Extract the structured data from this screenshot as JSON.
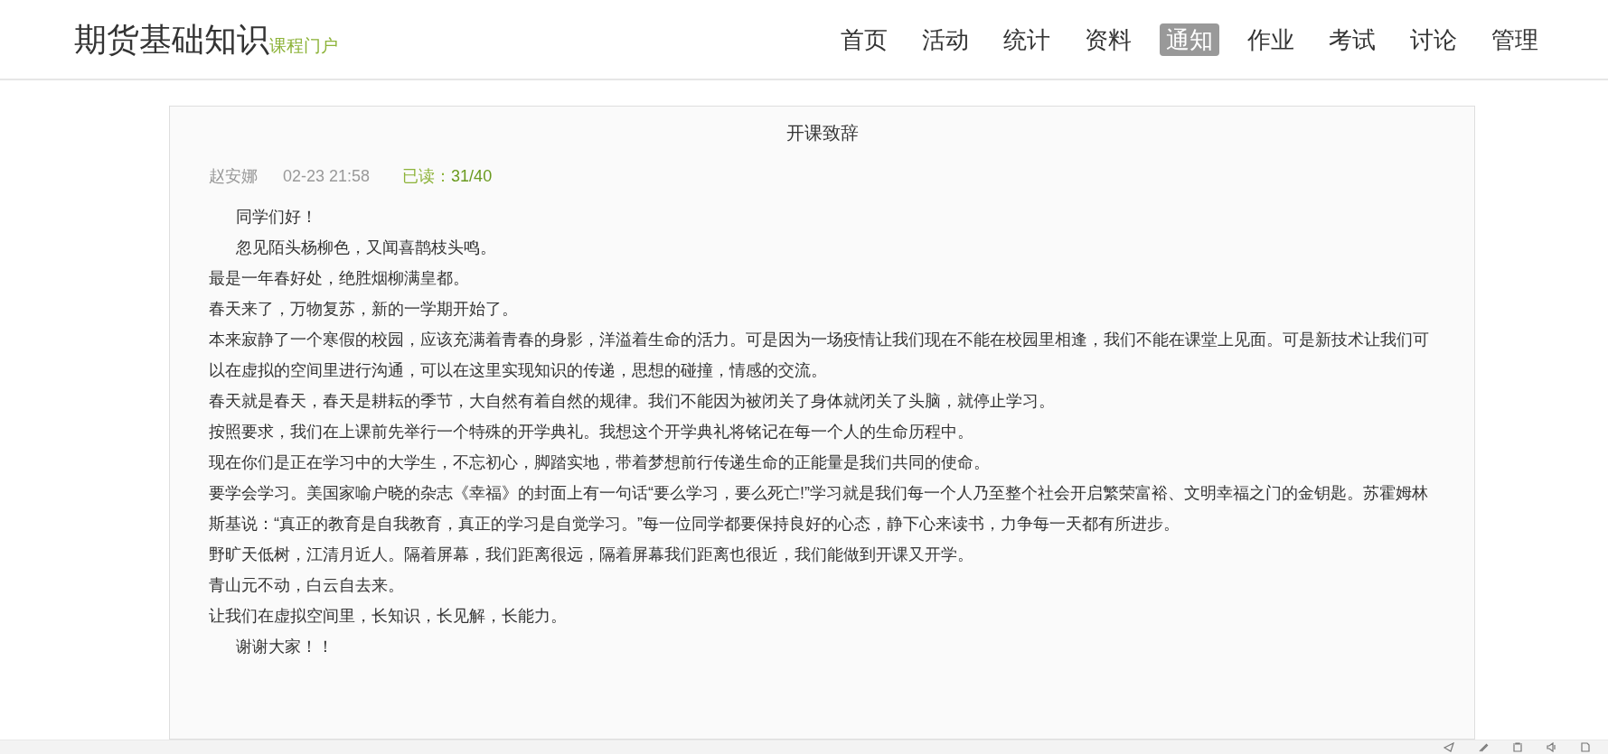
{
  "header": {
    "course_title": "期货基础知识",
    "portal_label": "课程门户"
  },
  "nav": [
    {
      "label": "首页",
      "selected": false
    },
    {
      "label": "活动",
      "selected": false
    },
    {
      "label": "统计",
      "selected": false
    },
    {
      "label": "资料",
      "selected": false
    },
    {
      "label": "通知",
      "selected": true
    },
    {
      "label": "作业",
      "selected": false
    },
    {
      "label": "考试",
      "selected": false
    },
    {
      "label": "讨论",
      "selected": false
    },
    {
      "label": "管理",
      "selected": false
    }
  ],
  "notice": {
    "title": "开课致辞",
    "author": "赵安娜",
    "time": "02-23 21:58",
    "read_label": "已读：",
    "read_count": "31/40",
    "paragraphs": [
      {
        "text": "同学们好！",
        "indent": true
      },
      {
        "text": "忽见陌头杨柳色，又闻喜鹊枝头鸣。",
        "indent": true
      },
      {
        "text": "最是一年春好处，绝胜烟柳满皇都。",
        "indent": false
      },
      {
        "text": "春天来了，万物复苏，新的一学期开始了。",
        "indent": false
      },
      {
        "text": "本来寂静了一个寒假的校园，应该充满着青春的身影，洋溢着生命的活力。可是因为一场疫情让我们现在不能在校园里相逢，我们不能在课堂上见面。可是新技术让我们可以在虚拟的空间里进行沟通，可以在这里实现知识的传递，思想的碰撞，情感的交流。",
        "indent": false
      },
      {
        "text": "春天就是春天，春天是耕耘的季节，大自然有着自然的规律。我们不能因为被闭关了身体就闭关了头脑，就停止学习。",
        "indent": false
      },
      {
        "text": "按照要求，我们在上课前先举行一个特殊的开学典礼。我想这个开学典礼将铭记在每一个人的生命历程中。",
        "indent": false
      },
      {
        "text": "现在你们是正在学习中的大学生，不忘初心，脚踏实地，带着梦想前行传递生命的正能量是我们共同的使命。",
        "indent": false
      },
      {
        "text": "要学会学习。美国家喻户晓的杂志《幸福》的封面上有一句话“要么学习，要么死亡!”学习就是我们每一个人乃至整个社会开启繁荣富裕、文明幸福之门的金钥匙。苏霍姆林斯基说：“真正的教育是自我教育，真正的学习是自觉学习。”每一位同学都要保持良好的心态，静下心来读书，力争每一天都有所进步。",
        "indent": false
      },
      {
        "text": "野旷天低树，江清月近人。隔着屏幕，我们距离很远，隔着屏幕我们距离也很近，我们能做到开课又开学。",
        "indent": false
      },
      {
        "text": "青山元不动，白云自去来。",
        "indent": false
      },
      {
        "text": "让我们在虚拟空间里，长知识，长见解，长能力。",
        "indent": false
      },
      {
        "text": "谢谢大家！！",
        "indent": true
      }
    ]
  }
}
